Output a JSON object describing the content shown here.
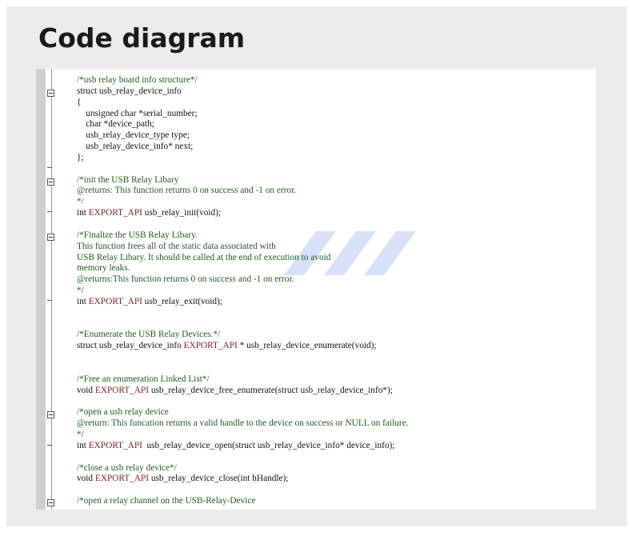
{
  "page": {
    "title": "Code diagram"
  },
  "code": {
    "lines": [
      {
        "t": "/*usb relay board info structure*/",
        "c": "cm"
      },
      {
        "t": "struct usb_relay_device_info",
        "c": ""
      },
      {
        "t": "{",
        "c": ""
      },
      {
        "t": "    unsigned char *serial_number;",
        "c": ""
      },
      {
        "t": "    char *device_path;",
        "c": ""
      },
      {
        "t": "    usb_relay_device_type type;",
        "c": ""
      },
      {
        "t": "    usb_relay_device_info* next;",
        "c": ""
      },
      {
        "t": "};",
        "c": ""
      },
      {
        "t": "",
        "c": ""
      },
      {
        "t": "/*init the USB Relay Libary",
        "c": "cm"
      },
      {
        "t": "@returns: This function returns 0 on success and -1 on error.",
        "c": "cm"
      },
      {
        "t": "*/",
        "c": "cm"
      },
      {
        "t": "int EXPORT_API usb_relay_init(void);",
        "c": "api"
      },
      {
        "t": "",
        "c": ""
      },
      {
        "t": "/*Finalize the USB Relay Libary.",
        "c": "cm"
      },
      {
        "t": "This function frees all of the static data associated with",
        "c": "cm"
      },
      {
        "t": "USB Relay Libary. It should be called at the end of execution to avoid",
        "c": "cm"
      },
      {
        "t": "memory leaks.",
        "c": "cm"
      },
      {
        "t": "@returns:This function returns 0 on success and -1 on error.",
        "c": "cm"
      },
      {
        "t": "*/",
        "c": "cm"
      },
      {
        "t": "int EXPORT_API usb_relay_exit(void);",
        "c": "api"
      },
      {
        "t": "",
        "c": ""
      },
      {
        "t": "",
        "c": ""
      },
      {
        "t": "/*Enumerate the USB Relay Devices.*/",
        "c": "cm"
      },
      {
        "t": "struct usb_relay_device_info EXPORT_API * usb_relay_device_enumerate(void);",
        "c": "api"
      },
      {
        "t": "",
        "c": ""
      },
      {
        "t": "",
        "c": ""
      },
      {
        "t": "/*Free an enumeration Linked List*/",
        "c": "cm"
      },
      {
        "t": "void EXPORT_API usb_relay_device_free_enumerate(struct usb_relay_device_info*);",
        "c": "api"
      },
      {
        "t": "",
        "c": ""
      },
      {
        "t": "/*open a usb relay device",
        "c": "cm"
      },
      {
        "t": "@return: This funcation returns a valid handle to the device on success or NULL on failure.",
        "c": "cm"
      },
      {
        "t": "*/",
        "c": "cm"
      },
      {
        "t": "int EXPORT_API  usb_relay_device_open(struct usb_relay_device_info* device_info);",
        "c": "api"
      },
      {
        "t": "",
        "c": ""
      },
      {
        "t": "/*close a usb relay device*/",
        "c": "cm"
      },
      {
        "t": "void EXPORT_API usb_relay_device_close(int hHandle);",
        "c": "api"
      },
      {
        "t": "",
        "c": ""
      },
      {
        "t": "/*open a relay channel on the USB-Relay-Device",
        "c": "cm"
      }
    ]
  },
  "colors": {
    "comment": "#1f5a1f",
    "macro": "#7a1f2a",
    "text": "#111111"
  }
}
